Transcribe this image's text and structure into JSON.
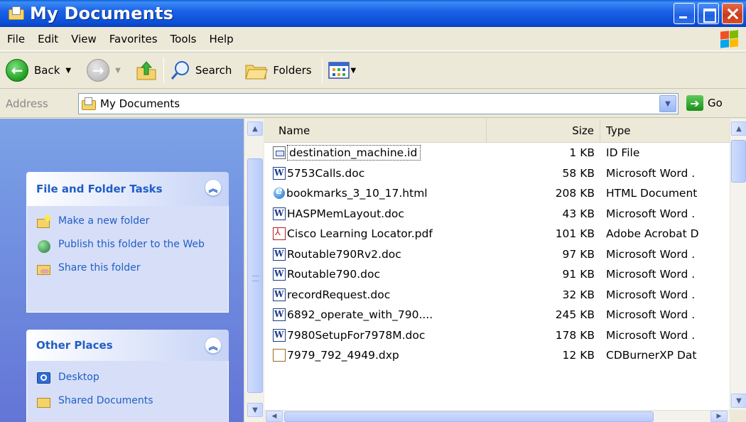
{
  "window": {
    "title": "My Documents"
  },
  "menu": [
    "File",
    "Edit",
    "View",
    "Favorites",
    "Tools",
    "Help"
  ],
  "toolbar": {
    "back": "Back",
    "search": "Search",
    "folders": "Folders"
  },
  "address": {
    "label": "Address",
    "value": "My Documents",
    "go": "Go"
  },
  "tasks_panel": {
    "title": "File and Folder Tasks",
    "items": [
      {
        "label": "Make a new folder",
        "icon": "new-folder-icon"
      },
      {
        "label": "Publish this folder to the Web",
        "icon": "publish-web-icon"
      },
      {
        "label": "Share this folder",
        "icon": "share-folder-icon"
      }
    ]
  },
  "places_panel": {
    "title": "Other Places",
    "items": [
      {
        "label": "Desktop",
        "icon": "desktop-icon"
      },
      {
        "label": "Shared Documents",
        "icon": "shared-documents-icon"
      }
    ]
  },
  "columns": {
    "name": "Name",
    "size": "Size",
    "type": "Type"
  },
  "files": [
    {
      "name": "destination_machine.id",
      "size": "1 KB",
      "type": "ID File",
      "icon": "id"
    },
    {
      "name": "5753Calls.doc",
      "size": "58 KB",
      "type": "Microsoft Word .",
      "icon": "word"
    },
    {
      "name": "bookmarks_3_10_17.html",
      "size": "208 KB",
      "type": "HTML Document",
      "icon": "html"
    },
    {
      "name": "HASPMemLayout.doc",
      "size": "43 KB",
      "type": "Microsoft Word .",
      "icon": "word"
    },
    {
      "name": "Cisco Learning Locator.pdf",
      "size": "101 KB",
      "type": "Adobe Acrobat D",
      "icon": "pdf"
    },
    {
      "name": "Routable790Rv2.doc",
      "size": "97 KB",
      "type": "Microsoft Word .",
      "icon": "word"
    },
    {
      "name": "Routable790.doc",
      "size": "91 KB",
      "type": "Microsoft Word .",
      "icon": "word"
    },
    {
      "name": "recordRequest.doc",
      "size": "32 KB",
      "type": "Microsoft Word .",
      "icon": "word"
    },
    {
      "name": "6892_operate_with_790....",
      "size": "245 KB",
      "type": "Microsoft Word .",
      "icon": "word"
    },
    {
      "name": "7980SetupFor7978M.doc",
      "size": "178 KB",
      "type": "Microsoft Word .",
      "icon": "word"
    },
    {
      "name": "7979_792_4949.dxp",
      "size": "12 KB",
      "type": "CDBurnerXP Dat",
      "icon": "dxp"
    }
  ],
  "colors": {
    "title_bar": "#0B4FD6",
    "task_pane": "#7BA2E7",
    "panel_link": "#215DC6"
  }
}
